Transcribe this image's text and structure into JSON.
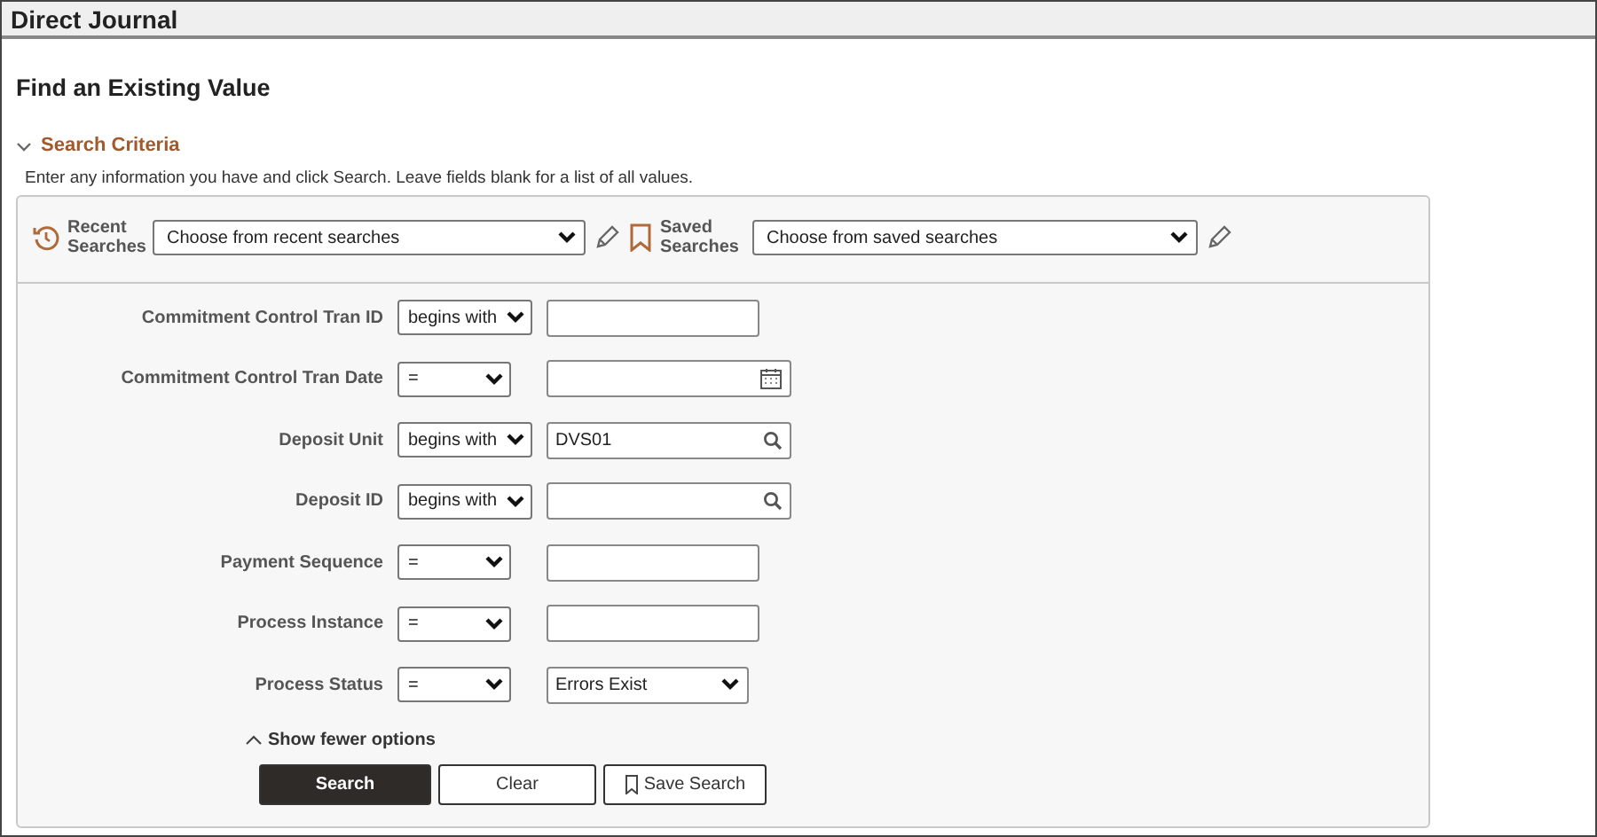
{
  "window": {
    "title": "Direct Journal"
  },
  "page_title": "Find an Existing Value",
  "section": {
    "title": "Search Criteria",
    "expanded": true
  },
  "instructions": "Enter any information you have and click Search. Leave fields blank for a list of all values.",
  "recent": {
    "label": "Recent Searches",
    "placeholder": "Choose from recent searches"
  },
  "saved": {
    "label": "Saved Searches",
    "placeholder": "Choose from saved searches"
  },
  "fields": [
    {
      "label": "Commitment Control Tran ID",
      "operator": "begins with",
      "kind": "text"
    },
    {
      "label": "Commitment Control Tran Date",
      "operator": "=",
      "kind": "date"
    },
    {
      "label": "Deposit Unit",
      "operator": "begins with",
      "kind": "lookup",
      "value": "DVS01"
    },
    {
      "label": "Deposit ID",
      "operator": "begins with",
      "kind": "lookup"
    },
    {
      "label": "Payment Sequence",
      "operator": "=",
      "kind": "text"
    },
    {
      "label": "Process Instance",
      "operator": "=",
      "kind": "text"
    },
    {
      "label": "Process Status",
      "operator": "=",
      "kind": "select",
      "value": "Errors Exist"
    }
  ],
  "toggle": {
    "label": "Show fewer options",
    "expanded": true
  },
  "buttons": [
    {
      "label": "Search",
      "kind": "primary"
    },
    {
      "label": "Clear",
      "kind": "plain"
    },
    {
      "label": "Save Search",
      "kind": "save"
    }
  ]
}
